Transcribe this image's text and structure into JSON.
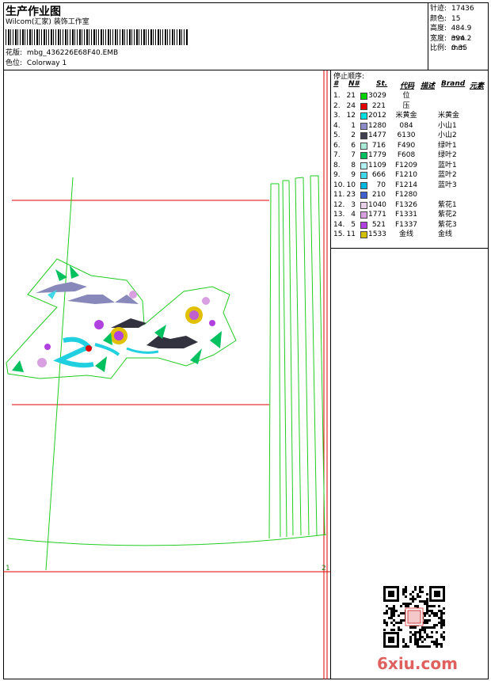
{
  "header": {
    "title": "生产作业图",
    "company": "Wilcom(汇家) 装饰工作室",
    "design_label": "花版:",
    "design_value": "mbg_436226E68F40.EMB",
    "colorway_label": "色位:",
    "colorway_value": "Colorway 1"
  },
  "stats": [
    {
      "label": "针迹:",
      "value": "17436"
    },
    {
      "label": "颜色:",
      "value": "15"
    },
    {
      "label": "高度:",
      "value": "484.9 mm"
    },
    {
      "label": "宽度:",
      "value": "394.2 mm"
    },
    {
      "label": "比例:",
      "value": "0.35"
    }
  ],
  "stop_sequence": {
    "title": "停止顺序:",
    "columns": [
      "#",
      "N#",
      "St.",
      "代码",
      "描述",
      "Brand",
      "元素"
    ],
    "rows": [
      {
        "idx": "1.",
        "n": "21",
        "color": "#00d400",
        "st": "3029",
        "code": "位",
        "desc": ""
      },
      {
        "idx": "2.",
        "n": "24",
        "color": "#e00000",
        "st": "221",
        "code": "压",
        "desc": ""
      },
      {
        "idx": "3.",
        "n": "12",
        "color": "#00e0e0",
        "st": "2012",
        "code": "米黄金",
        "desc": "米黄金"
      },
      {
        "idx": "4.",
        "n": "1",
        "color": "#8c8cc8",
        "st": "1280",
        "code": "084",
        "desc": "小山1"
      },
      {
        "idx": "5.",
        "n": "2",
        "color": "#404050",
        "st": "1477",
        "code": "6130",
        "desc": "小山2"
      },
      {
        "idx": "6.",
        "n": "6",
        "color": "#a8ecd8",
        "st": "716",
        "code": "F490",
        "desc": "绿叶1"
      },
      {
        "idx": "7.",
        "n": "7",
        "color": "#00c060",
        "st": "1779",
        "code": "F608",
        "desc": "绿叶2"
      },
      {
        "idx": "8.",
        "n": "8",
        "color": "#b0f0f0",
        "st": "1109",
        "code": "F1209",
        "desc": "蓝叶1"
      },
      {
        "idx": "9.",
        "n": "9",
        "color": "#40d8e8",
        "st": "666",
        "code": "F1210",
        "desc": "蓝叶2"
      },
      {
        "idx": "10.",
        "n": "10",
        "color": "#00b8e0",
        "st": "70",
        "code": "F1214",
        "desc": "蓝叶3"
      },
      {
        "idx": "11.",
        "n": "23",
        "color": "#4060d0",
        "st": "210",
        "code": "F1280",
        "desc": ""
      },
      {
        "idx": "12.",
        "n": "3",
        "color": "#e8d0e8",
        "st": "1040",
        "code": "F1326",
        "desc": "紫花1"
      },
      {
        "idx": "13.",
        "n": "4",
        "color": "#d8a0e0",
        "st": "1771",
        "code": "F1331",
        "desc": "紫花2"
      },
      {
        "idx": "14.",
        "n": "5",
        "color": "#b040e0",
        "st": "521",
        "code": "F1337",
        "desc": "紫花3"
      },
      {
        "idx": "15.",
        "n": "11",
        "color": "#d0c000",
        "st": "1533",
        "code": "金线",
        "desc": "金线"
      }
    ]
  },
  "canvas": {
    "marker_left": "1",
    "marker_right": "2"
  },
  "watermark": {
    "text": "6xiu.com",
    "seal_text": ""
  }
}
